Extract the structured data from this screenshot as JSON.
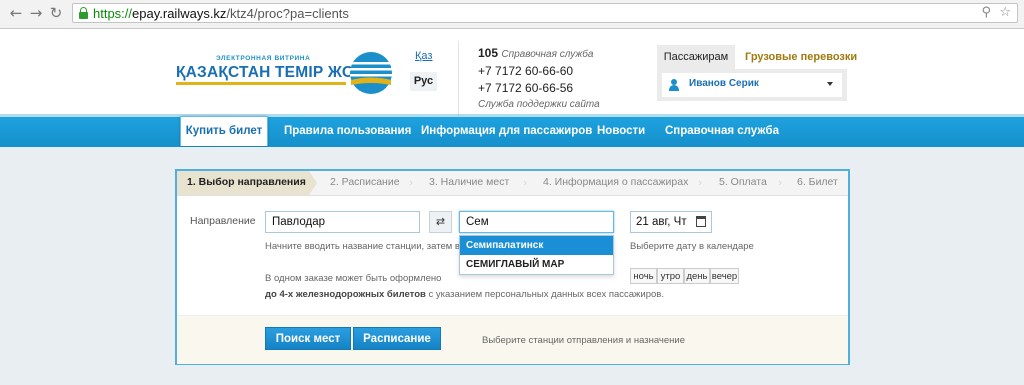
{
  "browser": {
    "url_protocol": "https://",
    "url_host": "epay.railways.kz",
    "url_path": "/ktz4/proc?pa=clients",
    "back_icon": "back-arrow-icon",
    "forward_icon": "forward-arrow-icon",
    "reload_icon": "reload-icon"
  },
  "header": {
    "logo_small_text": "ЭЛЕКТРОННАЯ ВИТРИНА",
    "logo_big_text": "ҚАЗАҚСТАН ТЕМІР ЖОЛЫ",
    "lang_kaz": "Қаз",
    "lang_rus": "Рус",
    "support_number": "105",
    "support_label": "Справочная служба",
    "phone1": "+7 7172 60-66-60",
    "phone2": "+7 7172 60-66-56",
    "site_support_label": "Служба поддержки сайта",
    "tab_passengers": "Пассажирам",
    "tab_cargo": "Грузовые перевозки",
    "user_name": "Иванов Серик"
  },
  "nav": {
    "items": [
      "Купить билет",
      "Правила пользования",
      "Информация для пассажиров",
      "Новости",
      "Справочная служба"
    ]
  },
  "steps": [
    "1. Выбор направления",
    "2. Расписание",
    "3. Наличие мест",
    "4. Информация о пассажирах",
    "5. Оплата",
    "6. Билет"
  ],
  "form": {
    "direction_label": "Направление",
    "from_value": "Павлодар",
    "to_value": "Сем",
    "date_value": "21 авг, Чт",
    "station_hint": "Начните вводить название станции, затем выбери",
    "date_hint": "Выберите дату в календаре",
    "order_hint_line1": "В одном заказе может быть оформлено",
    "order_hint_bold": "до 4-х железнодорожных билетов",
    "order_hint_rest": " с указанием персональных данных всех пассажиров.",
    "suggestions": [
      "Семипалатинск",
      "СЕМИГЛАВЫЙ МАР"
    ],
    "times_of_day": [
      "ночь",
      "утро",
      "день",
      "вечер"
    ],
    "search_button": "Поиск мест",
    "schedule_button": "Расписание",
    "footer_hint": "Выберите станции отправления и назначение"
  },
  "colors": {
    "nav_blue": "#1a9ad6",
    "panel_border": "#4fb0df",
    "active_step": "#e8e3cf",
    "cargo_gold": "#a07a10",
    "button_blue": "#1583c6"
  }
}
